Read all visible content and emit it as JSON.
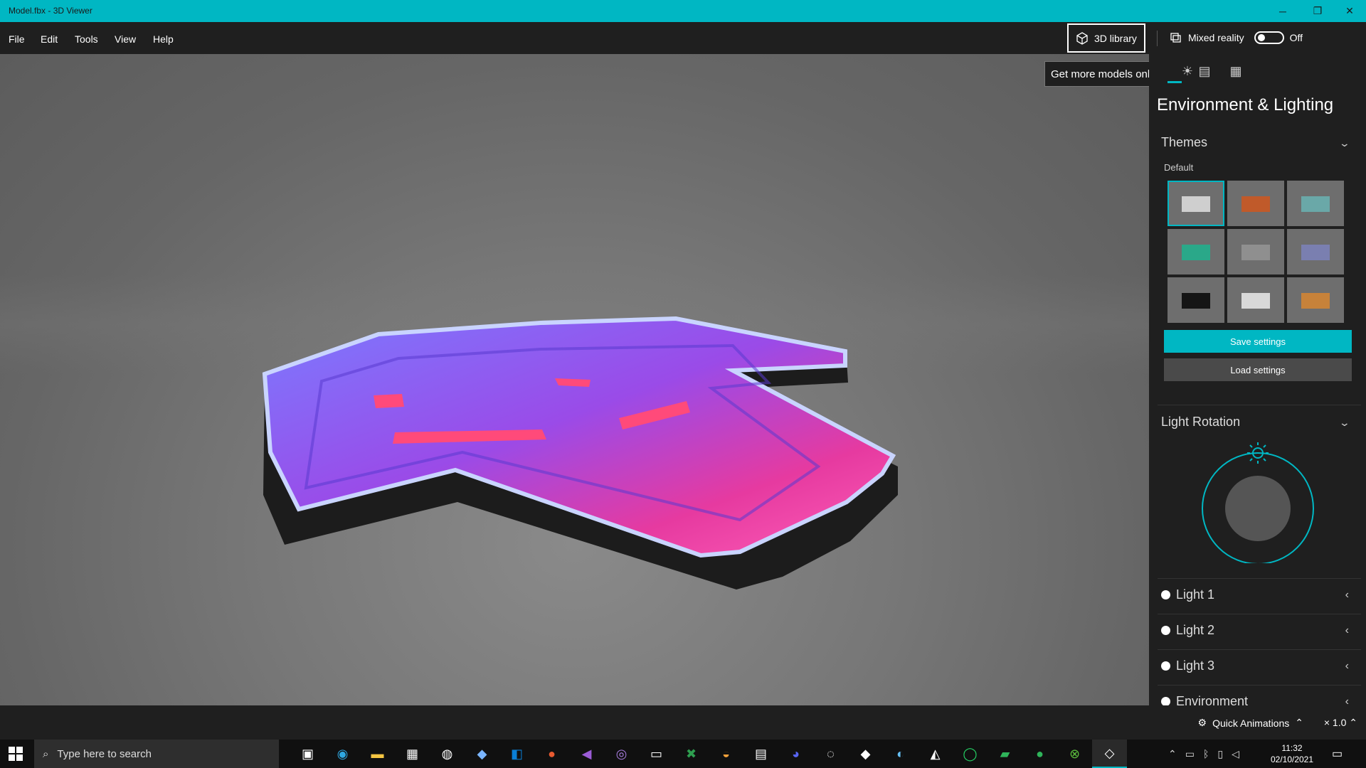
{
  "window": {
    "title": "Model.fbx - 3D Viewer",
    "minimize_icon": "─",
    "restore_icon": "❐",
    "close_icon": "✕"
  },
  "menu": [
    "File",
    "Edit",
    "Tools",
    "View",
    "Help"
  ],
  "toolbar": {
    "library_label": "3D library",
    "library_tooltip": "Get more models online",
    "mixed_reality_label": "Mixed reality",
    "mixed_reality_state": "Off"
  },
  "panel": {
    "title": "Environment & Lighting",
    "themes": {
      "heading": "Themes",
      "group_label": "Default",
      "selected_index": 0,
      "swatches": [
        "#cfcfcf",
        "#c05a2a",
        "#6aa8a8",
        "#2aa889",
        "#8f8f8f",
        "#7a7fb0",
        "#151515",
        "#d8d8d8",
        "#c7823a"
      ]
    },
    "save_label": "Save settings",
    "load_label": "Load settings",
    "light_rotation": {
      "heading": "Light Rotation"
    },
    "lights": [
      "Light 1",
      "Light 2",
      "Light 3",
      "Environment"
    ]
  },
  "statusbar": {
    "quick_animations": "Quick Animations",
    "zoom": "× 1.0"
  },
  "taskbar": {
    "search_placeholder": "Type here to search",
    "time": "11:32",
    "date": "02/10/2021"
  },
  "colors": {
    "accent": "#00b7c3",
    "load_button": "#4a4a4a"
  }
}
